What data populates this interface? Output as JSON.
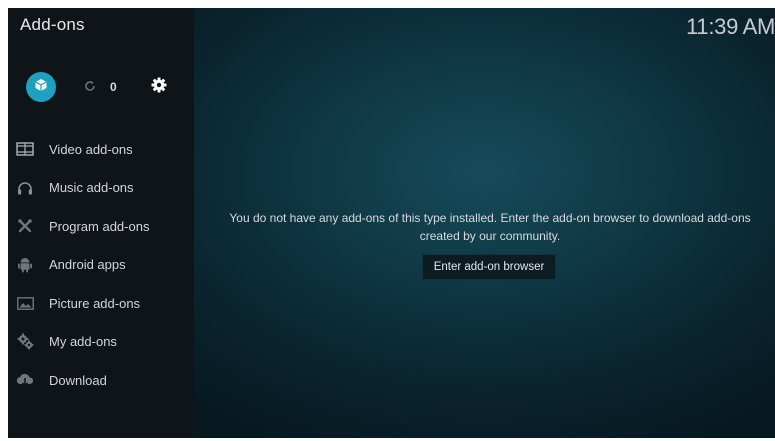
{
  "header": {
    "title": "Add-ons",
    "clock": "11:39 AM"
  },
  "toolbar": {
    "addon_browser_icon": "box-icon",
    "refresh_icon": "refresh-icon",
    "update_count": "0",
    "settings_icon": "gear-icon",
    "accent_color": "#1ea0c0"
  },
  "sidebar": {
    "items": [
      {
        "label": "Video add-ons",
        "icon": "film-icon"
      },
      {
        "label": "Music add-ons",
        "icon": "headphones-icon"
      },
      {
        "label": "Program add-ons",
        "icon": "tools-icon"
      },
      {
        "label": "Android apps",
        "icon": "android-icon"
      },
      {
        "label": "Picture add-ons",
        "icon": "picture-icon"
      },
      {
        "label": "My add-ons",
        "icon": "gears-icon"
      },
      {
        "label": "Download",
        "icon": "cloud-download-icon"
      }
    ]
  },
  "main": {
    "message": "You do not have any add-ons of this type installed. Enter the add-on browser to download add-ons created by our community.",
    "button_label": "Enter add-on browser"
  }
}
